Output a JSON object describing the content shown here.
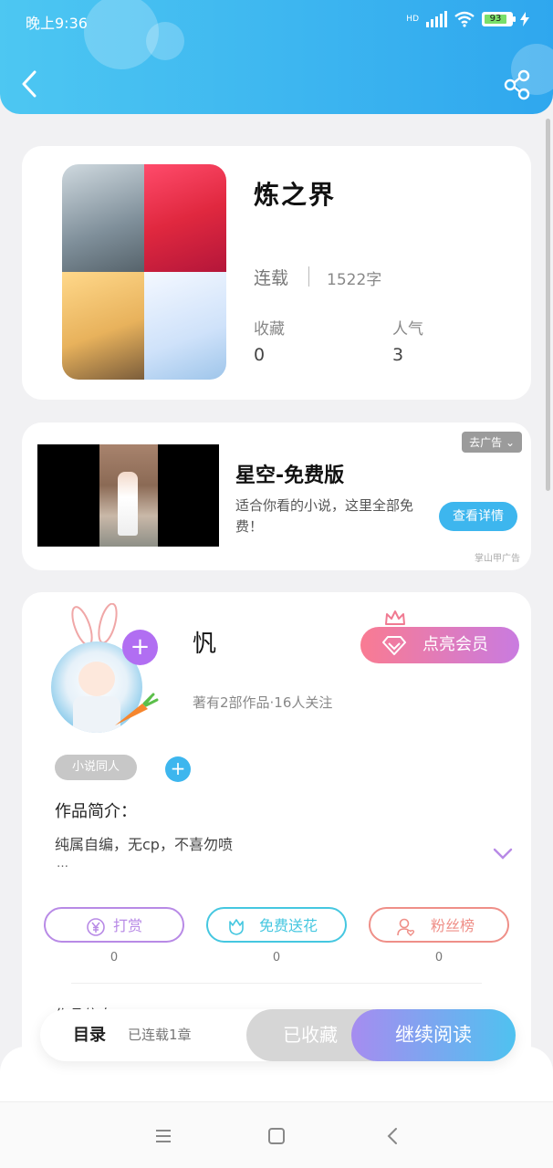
{
  "status_bar": {
    "time": "晚上9:36",
    "battery": "93",
    "network": "HD"
  },
  "book": {
    "title": "炼之界",
    "status": "连载",
    "word_count": "1522字",
    "favorites_label": "收藏",
    "favorites_value": "0",
    "popularity_label": "人气",
    "popularity_value": "3"
  },
  "ad": {
    "tag": "去广告",
    "title": "星空-免费版",
    "description": "适合你看的小说，这里全部免费！",
    "button": "查看详情",
    "source": "掌山甲广告"
  },
  "author": {
    "name": "忛",
    "meta": "著有2部作品·16人关注",
    "vip_button": "点亮会员",
    "tag": "小说同人",
    "intro_title": "作品简介：",
    "intro_text": "纯属自编，无cp，不喜勿喷",
    "intro_more": "…",
    "actions": [
      {
        "label": "打赏",
        "count": "0",
        "color": "#b88ae6"
      },
      {
        "label": "免费送花",
        "count": "0",
        "color": "#45c7e0"
      },
      {
        "label": "粉丝榜",
        "count": "0",
        "color": "#ef8f88"
      }
    ],
    "peek": "作品信息"
  },
  "bottom_bar": {
    "toc_label": "目录",
    "toc_count": "已连载1章",
    "collected": "已收藏",
    "read": "继续阅读"
  },
  "colors": {
    "header": "#3cb5f0",
    "accent": "#3db6ee",
    "vip": "#f97b92"
  }
}
